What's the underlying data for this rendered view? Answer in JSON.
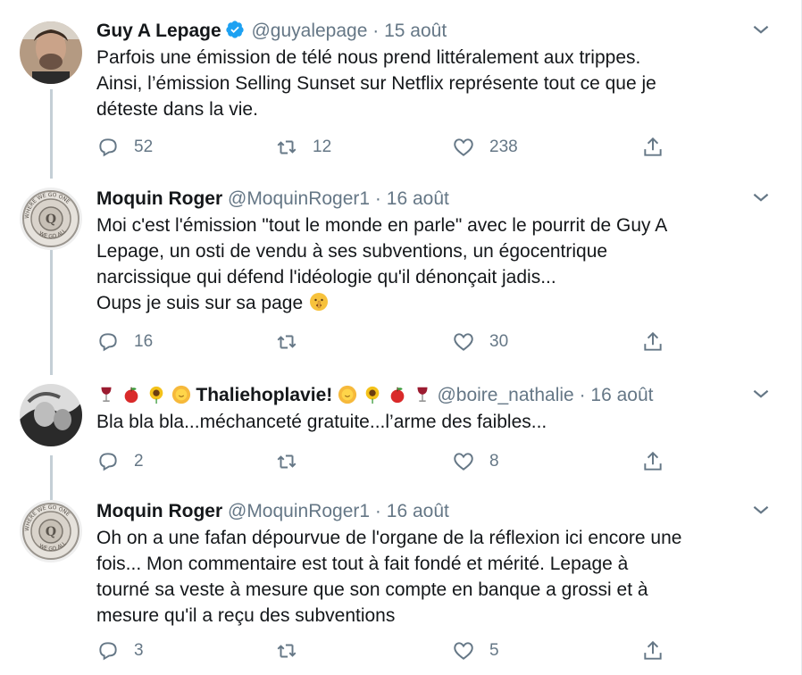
{
  "tweets": [
    {
      "name": "Guy A Lepage",
      "verified": true,
      "handle": "@guyalepage",
      "dot": "·",
      "date": "15 août",
      "lines": [
        "Parfois une émission de télé nous prend littéralement aux trippes.",
        "Ainsi, l’émission Selling Sunset sur Netflix représente tout ce que je",
        "déteste dans la vie."
      ],
      "replies": "52",
      "retweets": "12",
      "likes": "238",
      "avatar": "guy-photo"
    },
    {
      "name": "Moquin Roger",
      "handle": "@MoquinRoger1",
      "dot": "·",
      "date": "16 août",
      "lines": [
        "Moi c'est l'émission \"tout le monde en parle\" avec le pourrit de Guy A",
        "Lepage, un osti de vendu à ses subventions, un égocentrique",
        "narcissique qui défend l'idéologie qu'il dénonçait jadis...",
        "Oups je suis sur sa page"
      ],
      "trailing_emoji": "shushing-face",
      "replies": "16",
      "retweets": "",
      "likes": "30",
      "avatar": "seal-logo",
      "seal_text_top": "WHERE WE GO ONE",
      "seal_text_bottom": "WE GO ALL"
    },
    {
      "name_prefix_emoji": [
        "wine-glass",
        "apple",
        "sunflower",
        "sun-face"
      ],
      "name": "Thaliehoplavie!",
      "name_suffix_emoji": [
        "sun-face",
        "sunflower",
        "apple",
        "wine-glass"
      ],
      "handle": "@boire_nathalie",
      "dot": "·",
      "date": "16 août",
      "lines": [
        "Bla bla bla...méchanceté gratuite...l’arme des faibles..."
      ],
      "replies": "2",
      "retweets": "",
      "likes": "8",
      "avatar": "bw-photo"
    },
    {
      "name": "Moquin Roger",
      "handle": "@MoquinRoger1",
      "dot": "·",
      "date": "16 août",
      "lines": [
        "Oh on a une fafan dépourvue de l'organe de la réflexion ici encore une",
        "fois... Mon commentaire est tout à fait fondé et mérité. Lepage à",
        "tourné sa veste à mesure que son compte en banque a grossi et à",
        "mesure qu'il a reçu des subventions"
      ],
      "replies": "3",
      "retweets": "",
      "likes": "5",
      "avatar": "seal-logo",
      "seal_text_top": "WHERE WE GO ONE",
      "seal_text_bottom": "WE GO ALL"
    }
  ],
  "colors": {
    "text": "#14171a",
    "muted": "#657786",
    "verified": "#1da1f2",
    "thread_line": "#c4cfd6"
  }
}
